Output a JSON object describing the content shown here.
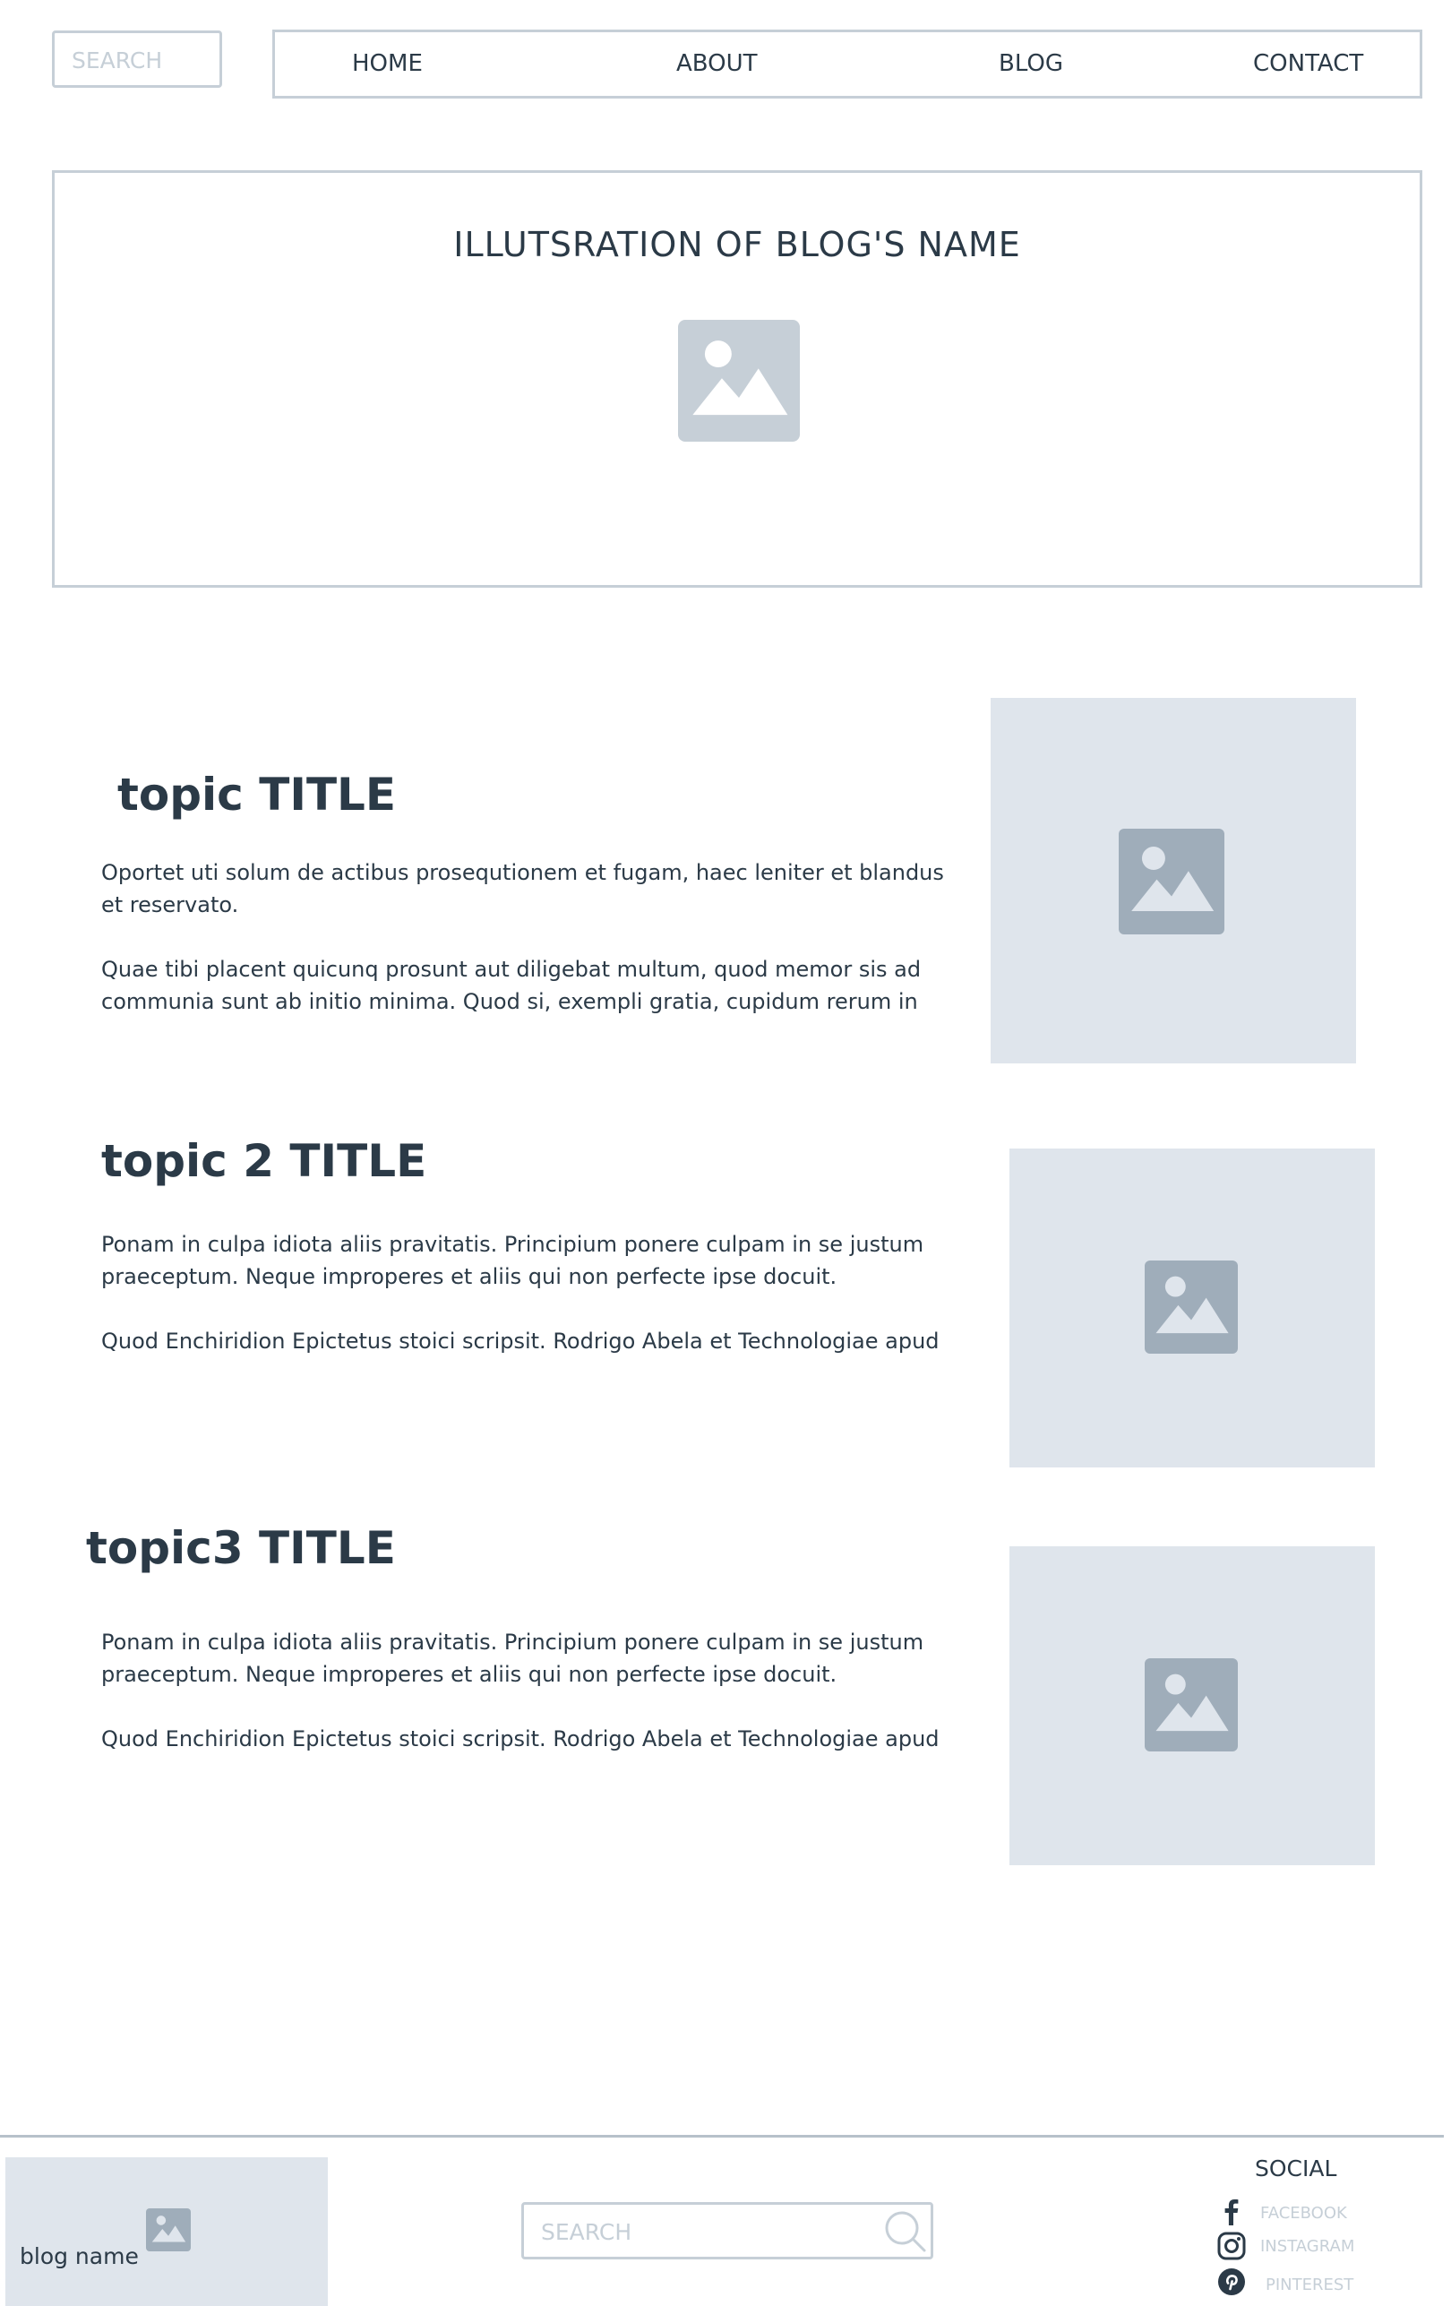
{
  "header": {
    "search_placeholder": "SEARCH",
    "nav": [
      "HOME",
      "ABOUT",
      "BLOG",
      "CONTACT"
    ]
  },
  "hero": {
    "title": "ILLUTSRATION OF BLOG'S NAME",
    "image_icon": "image-placeholder-icon"
  },
  "topics": [
    {
      "title": "topic TITLE",
      "paragraphs": [
        "Oportet uti solum de actibus prosequtionem et fugam, haec leniter et blandus et reservato.",
        "Quae tibi placent quicunq prosunt aut diligebat multum, quod memor sis ad communia sunt ab initio minima. Quod si, exempli gratia, cupidum rerum in"
      ]
    },
    {
      "title": "topic 2 TITLE",
      "paragraphs": [
        "Ponam in culpa idiota aliis pravitatis. Principium ponere culpam in se justum praeceptum. Neque improperes et aliis qui non perfecte ipse docuit.",
        "Quod Enchiridion Epictetus stoici scripsit. Rodrigo Abela et Technologiae apud"
      ]
    },
    {
      "title": "topic3 TITLE",
      "paragraphs": [
        "Ponam in culpa idiota aliis pravitatis. Principium ponere culpam in se justum praeceptum. Neque improperes et aliis qui non perfecte ipse docuit.",
        "Quod Enchiridion Epictetus stoici scripsit. Rodrigo Abela et Technologiae apud"
      ]
    }
  ],
  "footer": {
    "brand_name": "blog name",
    "search_placeholder": "SEARCH",
    "social_title": "SOCIAL",
    "social": [
      {
        "label": "FACEBOOK",
        "icon": "facebook-icon"
      },
      {
        "label": "INSTAGRAM",
        "icon": "instagram-icon"
      },
      {
        "label": "PINTEREST",
        "icon": "pinterest-icon"
      }
    ]
  },
  "colors": {
    "text": "#2b3a47",
    "border": "#c6cfd7",
    "placeholder_bg": "#dfe5ec",
    "icon": "#9fadba"
  }
}
